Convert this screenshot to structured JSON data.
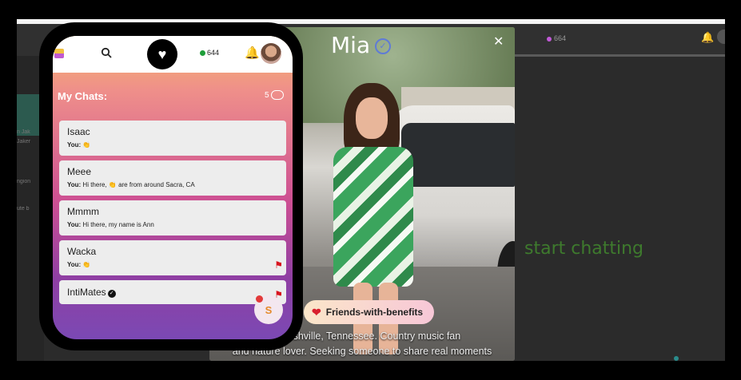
{
  "background": {
    "online_count": "664",
    "center_text": "start chatting",
    "sidebar_snippets": [
      "n Jak",
      "Jaker",
      "ngion",
      "ute b"
    ]
  },
  "profile": {
    "name": "Mia",
    "tag": "Friends-with-benefits",
    "bio_line1": "om Nashville, Tennessee. Country music fan",
    "bio_line2": "and nature lover. Seeking someone to share real moments"
  },
  "phone": {
    "online_count": "644",
    "chats_title": "My Chats:",
    "chats_count": "5",
    "fab_label": "S",
    "chats": [
      {
        "name": "Isaac",
        "you": "You:",
        "preview": "👏",
        "flag": false
      },
      {
        "name": "Meee",
        "you": "You:",
        "preview": "Hi there, 👏 are from around Sacra, CA",
        "flag": false
      },
      {
        "name": "Mmmm",
        "you": "You:",
        "preview": "Hi there, my name is Ann",
        "flag": false
      },
      {
        "name": "Wacka",
        "you": "You:",
        "preview": "👏",
        "flag": true
      },
      {
        "name": "IntiMates",
        "you": "",
        "preview": "",
        "flag": true,
        "verified": true
      }
    ]
  },
  "icons": {
    "search": "search-icon",
    "heart": "heart-icon",
    "bell": "bell-icon",
    "flag": "flag-icon",
    "close": "close-icon",
    "verified": "verified-badge-icon"
  },
  "colors": {
    "flag": "#d8141e",
    "online": "#1e9e3a",
    "gradient_top": "#f5b86b",
    "gradient_bottom": "#7b49b4"
  }
}
